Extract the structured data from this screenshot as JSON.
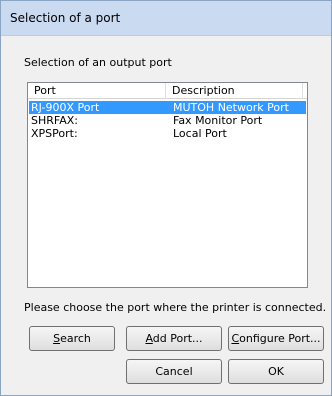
{
  "window": {
    "title": "Selection of a port"
  },
  "main": {
    "section_label": "Selection of an output port",
    "columns": [
      "Port",
      "Description"
    ],
    "rows": [
      {
        "port": "RJ-900X Port",
        "description": "MUTOH Network Port",
        "selected": true
      },
      {
        "port": "SHRFAX:",
        "description": "Fax Monitor Port",
        "selected": false
      },
      {
        "port": "XPSPort:",
        "description": "Local Port",
        "selected": false
      }
    ],
    "hint": "Please choose the port where the printer is connected."
  },
  "buttons": {
    "search": {
      "mnemonic": "S",
      "rest": "earch"
    },
    "add_port": {
      "mnemonic": "A",
      "rest": "dd Port..."
    },
    "configure_port": {
      "mnemonic": "C",
      "rest": "onfigure Port..."
    },
    "cancel": "Cancel",
    "ok": "OK"
  },
  "colors": {
    "selection": "#3399ff",
    "titlebar": "#c9daf1",
    "dialog_bg": "#f0f0f0"
  }
}
